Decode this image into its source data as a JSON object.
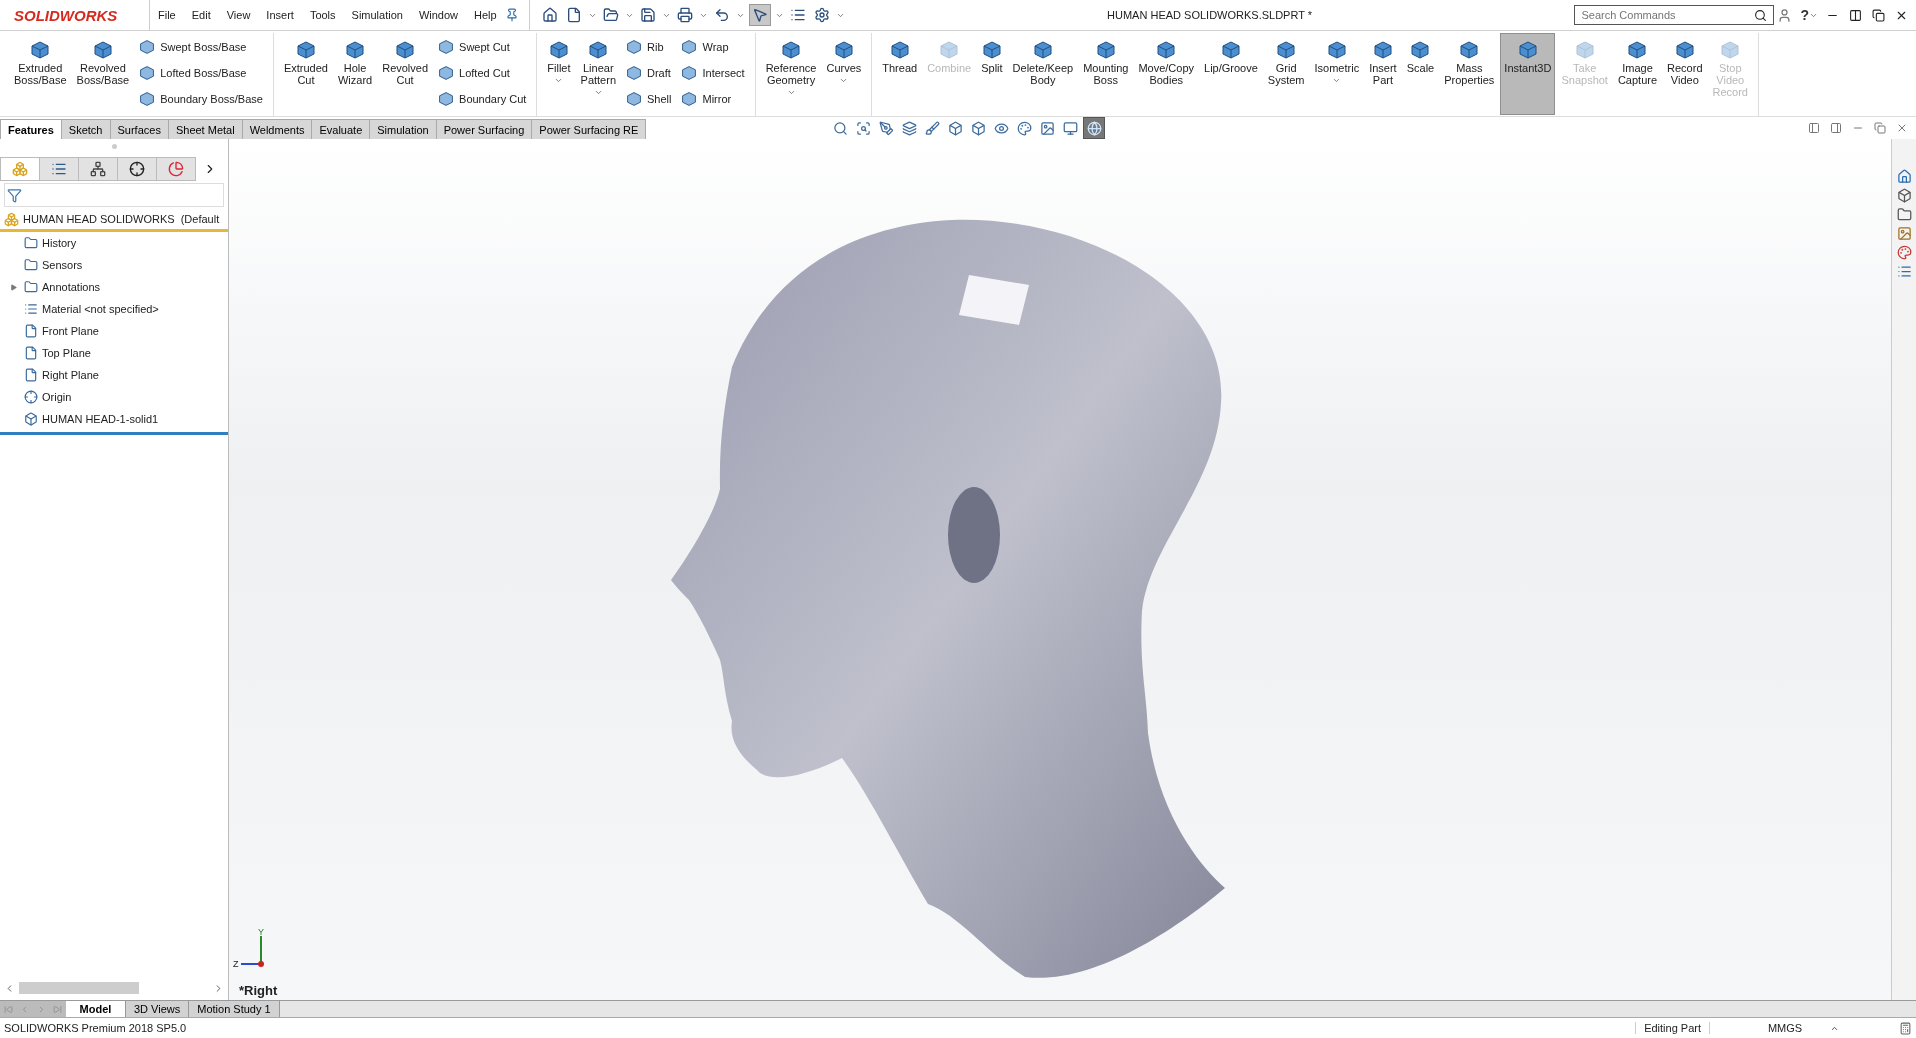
{
  "app": {
    "logo": "SOLIDWORKS"
  },
  "menu": [
    "File",
    "Edit",
    "View",
    "Insert",
    "Tools",
    "Simulation",
    "Window",
    "Help"
  ],
  "title": "HUMAN HEAD SOLIDWORKS.SLDPRT *",
  "search": {
    "placeholder": "Search Commands"
  },
  "help_label": "?",
  "ribbon": [
    {
      "items": [
        {
          "kind": "large",
          "label": "Extruded\nBoss/Base",
          "disabled": false,
          "selected": false,
          "dropdown": false
        },
        {
          "kind": "large",
          "label": "Revolved\nBoss/Base",
          "disabled": false,
          "selected": false,
          "dropdown": false
        },
        {
          "kind": "stack",
          "entries": [
            "Swept Boss/Base",
            "Lofted Boss/Base",
            "Boundary Boss/Base"
          ]
        }
      ]
    },
    {
      "items": [
        {
          "kind": "large",
          "label": "Extruded\nCut",
          "disabled": false,
          "selected": false,
          "dropdown": false
        },
        {
          "kind": "large",
          "label": "Hole\nWizard",
          "disabled": false,
          "selected": false,
          "dropdown": false
        },
        {
          "kind": "large",
          "label": "Revolved\nCut",
          "disabled": false,
          "selected": false,
          "dropdown": false
        },
        {
          "kind": "stack",
          "entries": [
            "Swept Cut",
            "Lofted Cut",
            "Boundary Cut"
          ]
        }
      ]
    },
    {
      "items": [
        {
          "kind": "large",
          "label": "Fillet",
          "disabled": false,
          "selected": false,
          "dropdown": true
        },
        {
          "kind": "large",
          "label": "Linear\nPattern",
          "disabled": false,
          "selected": false,
          "dropdown": true
        },
        {
          "kind": "stack",
          "entries": [
            "Rib",
            "Draft",
            "Shell"
          ]
        },
        {
          "kind": "stack",
          "entries": [
            "Wrap",
            "Intersect",
            "Mirror"
          ]
        }
      ]
    },
    {
      "items": [
        {
          "kind": "large",
          "label": "Reference\nGeometry",
          "disabled": false,
          "selected": false,
          "dropdown": true
        },
        {
          "kind": "large",
          "label": "Curves",
          "disabled": false,
          "selected": false,
          "dropdown": true
        }
      ]
    },
    {
      "items": [
        {
          "kind": "large",
          "label": "Thread",
          "disabled": false,
          "selected": false,
          "dropdown": false
        },
        {
          "kind": "large",
          "label": "Combine",
          "disabled": true,
          "selected": false,
          "dropdown": false
        },
        {
          "kind": "large",
          "label": "Split",
          "disabled": false,
          "selected": false,
          "dropdown": false
        },
        {
          "kind": "large",
          "label": "Delete/Keep\nBody",
          "disabled": false,
          "selected": false,
          "dropdown": false
        },
        {
          "kind": "large",
          "label": "Mounting\nBoss",
          "disabled": false,
          "selected": false,
          "dropdown": false
        },
        {
          "kind": "large",
          "label": "Move/Copy\nBodies",
          "disabled": false,
          "selected": false,
          "dropdown": false
        },
        {
          "kind": "large",
          "label": "Lip/Groove",
          "disabled": false,
          "selected": false,
          "dropdown": false
        },
        {
          "kind": "large",
          "label": "Grid\nSystem",
          "disabled": false,
          "selected": false,
          "dropdown": false
        },
        {
          "kind": "large",
          "label": "Isometric",
          "disabled": false,
          "selected": false,
          "dropdown": true
        },
        {
          "kind": "large",
          "label": "Insert\nPart",
          "disabled": false,
          "selected": false,
          "dropdown": false
        },
        {
          "kind": "large",
          "label": "Scale",
          "disabled": false,
          "selected": false,
          "dropdown": false
        },
        {
          "kind": "large",
          "label": "Mass\nProperties",
          "disabled": false,
          "selected": false,
          "dropdown": false
        },
        {
          "kind": "large",
          "label": "Instant3D",
          "disabled": false,
          "selected": true,
          "dropdown": false
        },
        {
          "kind": "large",
          "label": "Take\nSnapshot",
          "disabled": true,
          "selected": false,
          "dropdown": false
        },
        {
          "kind": "large",
          "label": "Image\nCapture",
          "disabled": false,
          "selected": false,
          "dropdown": false
        },
        {
          "kind": "large",
          "label": "Record\nVideo",
          "disabled": false,
          "selected": false,
          "dropdown": false
        },
        {
          "kind": "large",
          "label": "Stop\nVideo\nRecord",
          "disabled": true,
          "selected": false,
          "dropdown": false
        }
      ]
    }
  ],
  "command_tabs": [
    {
      "label": "Features",
      "selected": true
    },
    {
      "label": "Sketch",
      "selected": false
    },
    {
      "label": "Surfaces",
      "selected": false
    },
    {
      "label": "Sheet Metal",
      "selected": false
    },
    {
      "label": "Weldments",
      "selected": false
    },
    {
      "label": "Evaluate",
      "selected": false
    },
    {
      "label": "Simulation",
      "selected": false
    },
    {
      "label": "Power Surfacing",
      "selected": false
    },
    {
      "label": "Power Surfacing RE",
      "selected": false
    }
  ],
  "feature_tree": {
    "root": "HUMAN HEAD SOLIDWORKS  (Default",
    "items": [
      {
        "kind": "history",
        "label": "History",
        "has_children": false
      },
      {
        "kind": "sensor",
        "label": "Sensors",
        "has_children": false
      },
      {
        "kind": "annotation",
        "label": "Annotations",
        "has_children": true
      },
      {
        "kind": "material",
        "label": "Material <not specified>",
        "has_children": false
      },
      {
        "kind": "plane",
        "label": "Front Plane",
        "has_children": false
      },
      {
        "kind": "plane",
        "label": "Top Plane",
        "has_children": false
      },
      {
        "kind": "plane",
        "label": "Right Plane",
        "has_children": false
      },
      {
        "kind": "origin",
        "label": "Origin",
        "has_children": false
      },
      {
        "kind": "body",
        "label": "HUMAN HEAD-1-solid1",
        "has_children": false
      }
    ]
  },
  "viewport": {
    "view_label": "*Right",
    "axis_y": "Y",
    "axis_z": "Z"
  },
  "bottom_tabs": [
    {
      "label": "Model",
      "selected": true
    },
    {
      "label": "3D Views",
      "selected": false
    },
    {
      "label": "Motion Study 1",
      "selected": false
    }
  ],
  "status_bar": {
    "version": "SOLIDWORKS Premium 2018 SP5.0",
    "mode": "Editing Part",
    "units": "MMGS"
  }
}
